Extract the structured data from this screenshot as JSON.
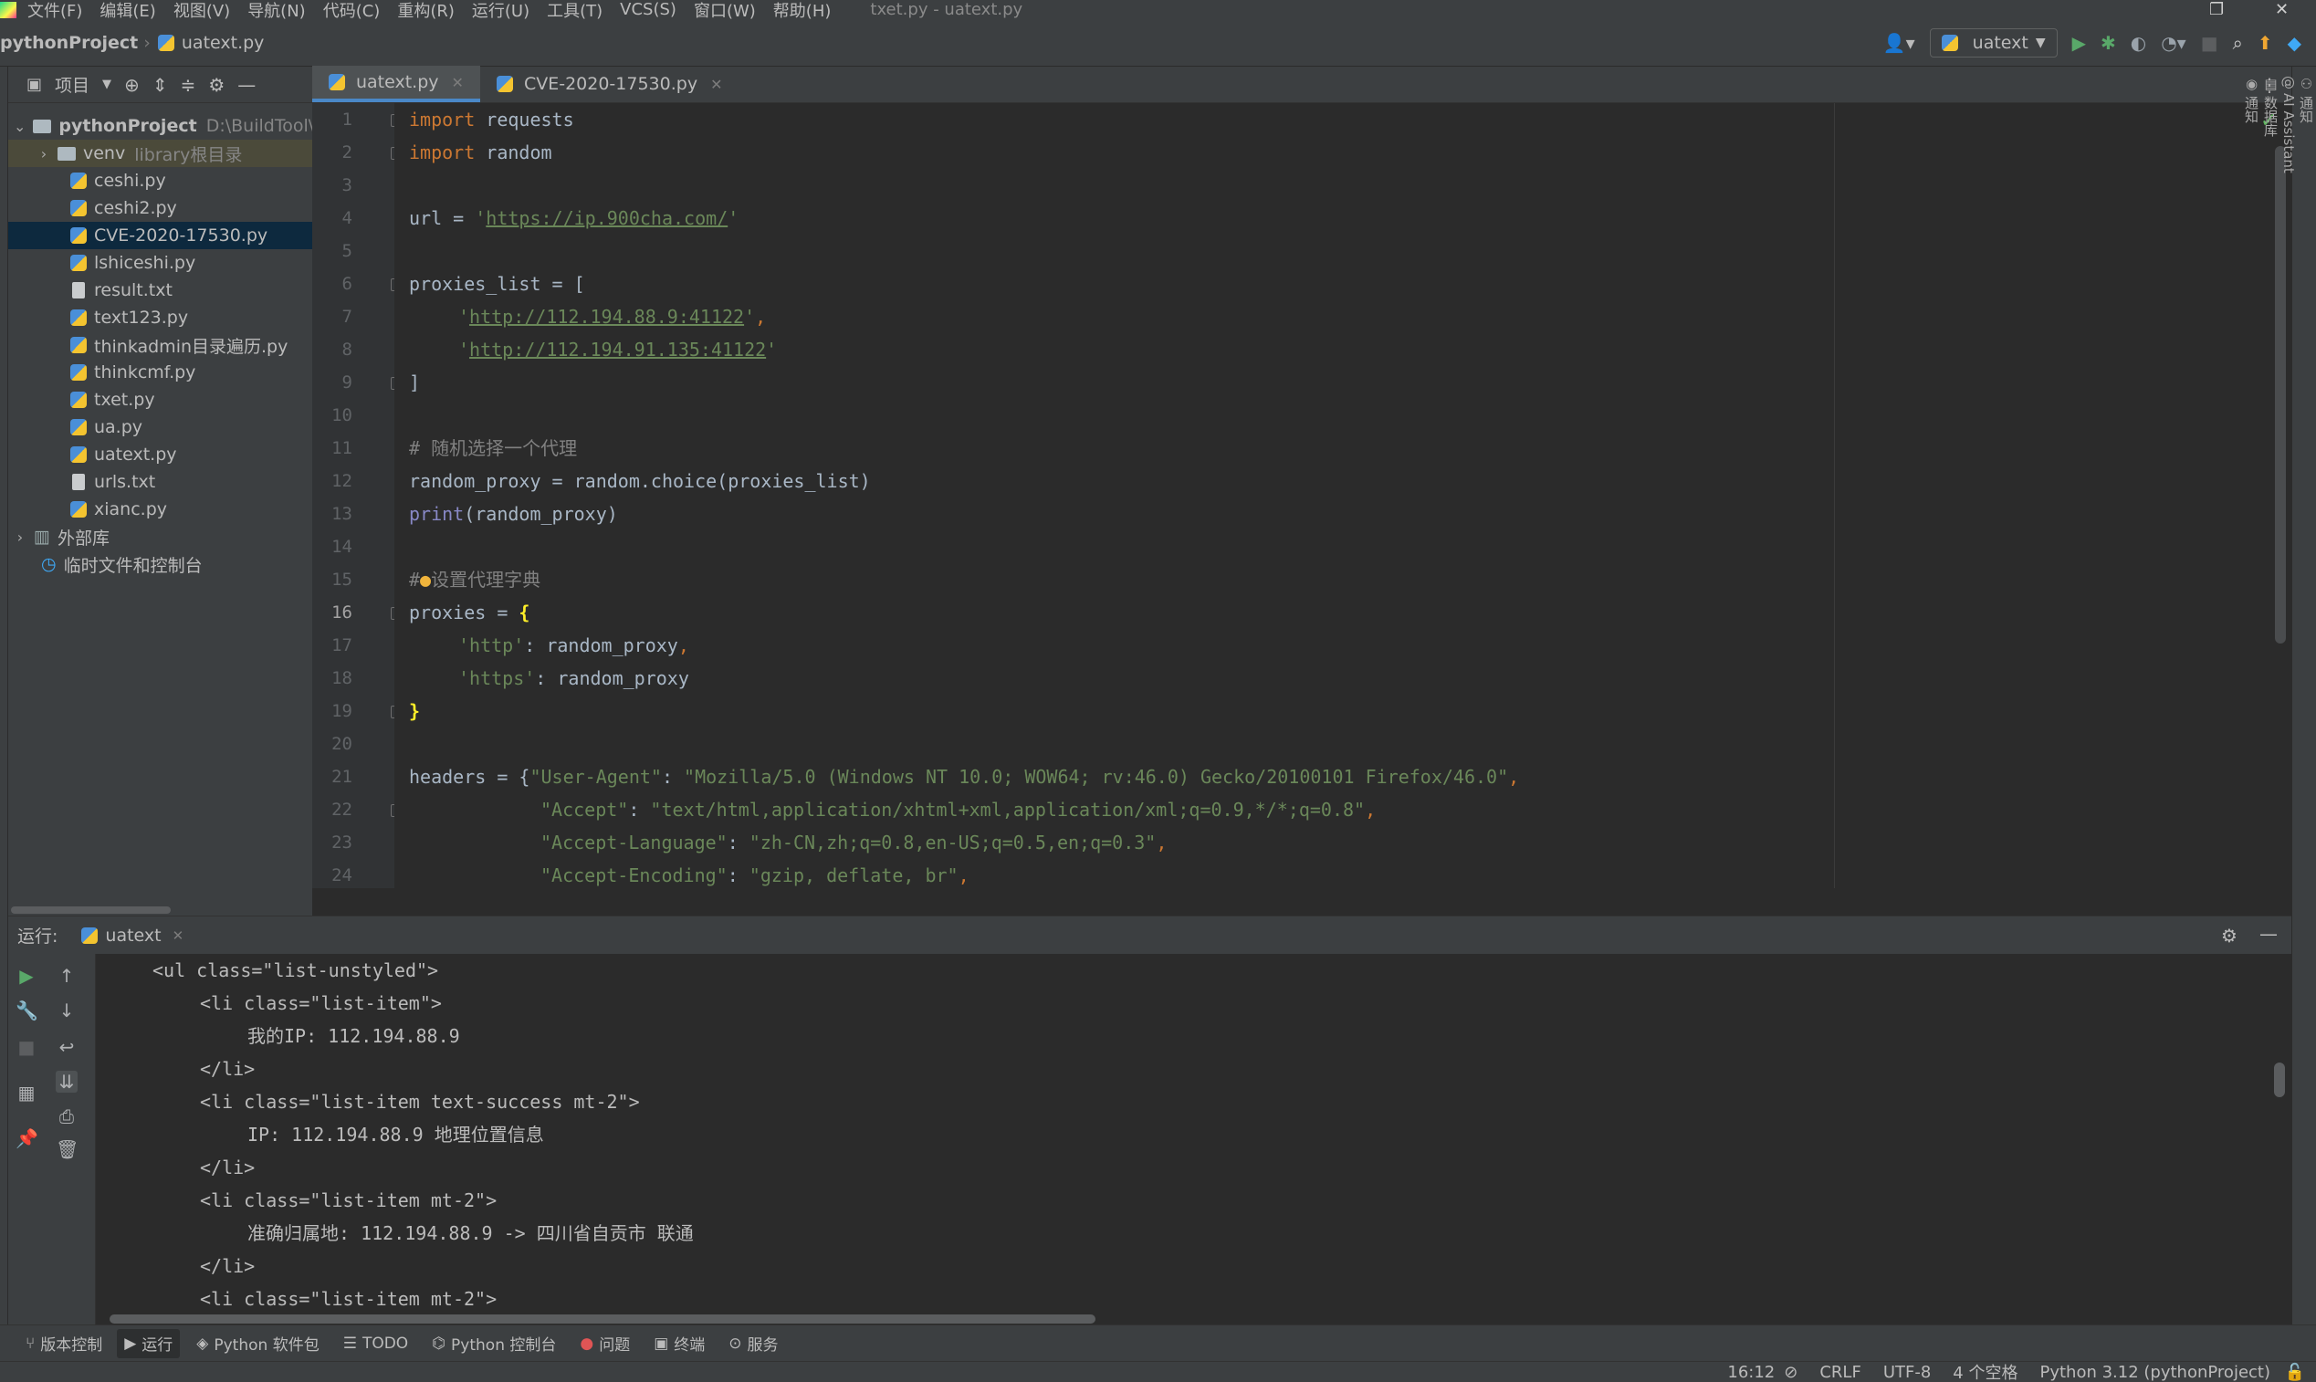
{
  "window": {
    "title": "txet.py - uatext.py",
    "menu": [
      "文件(F)",
      "编辑(E)",
      "视图(V)",
      "导航(N)",
      "代码(C)",
      "重构(R)",
      "运行(U)",
      "工具(T)",
      "VCS(S)",
      "窗口(W)",
      "帮助(H)"
    ]
  },
  "navbar": {
    "project": "pythonProject",
    "file": "uatext.py",
    "run_config": "uatext"
  },
  "project_panel": {
    "title": "项目",
    "root": {
      "name": "pythonProject",
      "path": "D:\\BuildTool\\Py"
    },
    "venv": {
      "name": "venv",
      "hint": "library根目录"
    },
    "files": [
      "ceshi.py",
      "ceshi2.py",
      "CVE-2020-17530.py",
      "lshiceshi.py",
      "result.txt",
      "text123.py",
      "thinkadmin目录遍历.py",
      "thinkcmf.py",
      "txet.py",
      "ua.py",
      "uatext.py",
      "urls.txt",
      "xianc.py"
    ],
    "external_libs": "外部库",
    "scratches": "临时文件和控制台"
  },
  "tabs": [
    {
      "label": "uatext.py"
    },
    {
      "label": "CVE-2020-17530.py"
    }
  ],
  "editor": {
    "line_numbers": [
      "1",
      "2",
      "3",
      "4",
      "5",
      "6",
      "7",
      "8",
      "9",
      "10",
      "11",
      "12",
      "13",
      "14",
      "15",
      "16",
      "17",
      "18",
      "19",
      "20",
      "21",
      "22",
      "23",
      "24"
    ],
    "l1": {
      "kw": "import",
      "rest": " requests"
    },
    "l2": {
      "kw": "import",
      "rest": " random"
    },
    "l4": {
      "a": "url = ",
      "q1": "'",
      "url": "https://ip.900cha.com/",
      "q2": "'"
    },
    "l6": "proxies_list = [",
    "l7": {
      "q1": "'",
      "url": "http://112.194.88.9:41122",
      "q2": "'",
      "comma": ","
    },
    "l8": {
      "q1": "'",
      "url": "http://112.194.91.135:41122",
      "q2": "'"
    },
    "l9": "]",
    "l11": "# 随机选择一个代理",
    "l12": "random_proxy = random.choice(proxies_list)",
    "l13": {
      "fn": "print",
      "rest": "(random_proxy)"
    },
    "l15a": "#",
    "l15b": "设置代理字典",
    "l16": {
      "a": "proxies = ",
      "b": "{"
    },
    "l17": {
      "s": "'http'",
      "rest": ": random_proxy",
      "comma": ","
    },
    "l18": {
      "s": "'https'",
      "rest": ": random_proxy"
    },
    "l19": "}",
    "l21": {
      "a": "headers = {",
      "k": "\"User-Agent\"",
      "c": ": ",
      "v": "\"Mozilla/5.0 (Windows NT 10.0; WOW64; rv:46.0) Gecko/20100101 Firefox/46.0\"",
      "e": ","
    },
    "l22": {
      "k": "\"Accept\"",
      "c": ": ",
      "v": "\"text/html,application/xhtml+xml,application/xml;q=0.9,*/*;q=0.8\"",
      "e": ","
    },
    "l23": {
      "k": "\"Accept-Language\"",
      "c": ": ",
      "v": "\"zh-CN,zh;q=0.8,en-US;q=0.5,en;q=0.3\"",
      "e": ","
    },
    "l24": {
      "k": "\"Accept-Encoding\"",
      "c": ": ",
      "v": "\"gzip, deflate, br\"",
      "e": ","
    }
  },
  "run": {
    "label": "运行:",
    "tab": "uatext",
    "console": [
      "<ul class=\"list-unstyled\">",
      "<li class=\"list-item\">",
      "我的IP: 112.194.88.9",
      "</li>",
      "<li class=\"list-item text-success mt-2\">",
      "IP: 112.194.88.9 地理位置信息",
      "</li>",
      "<li class=\"list-item mt-2\">",
      "准确归属地: 112.194.88.9 -> 四川省自贡市 联通",
      "</li>",
      "<li class=\"list-item mt-2\">"
    ]
  },
  "bottom_tools": [
    "版本控制",
    "运行",
    "Python 软件包",
    "TODO",
    "Python 控制台",
    "问题",
    "终端",
    "服务"
  ],
  "status": {
    "position": "16:12",
    "line_sep": "CRLF",
    "encoding": "UTF-8",
    "indent": "4 个空格",
    "interpreter": "Python 3.12 (pythonProject)"
  },
  "right_strip": [
    "通知",
    "AI Assistant",
    "数据库",
    "通知"
  ],
  "colors": {
    "keyword": "#cc7832",
    "string": "#6a8759",
    "comment": "#808080",
    "accent": "#4a88c7"
  }
}
